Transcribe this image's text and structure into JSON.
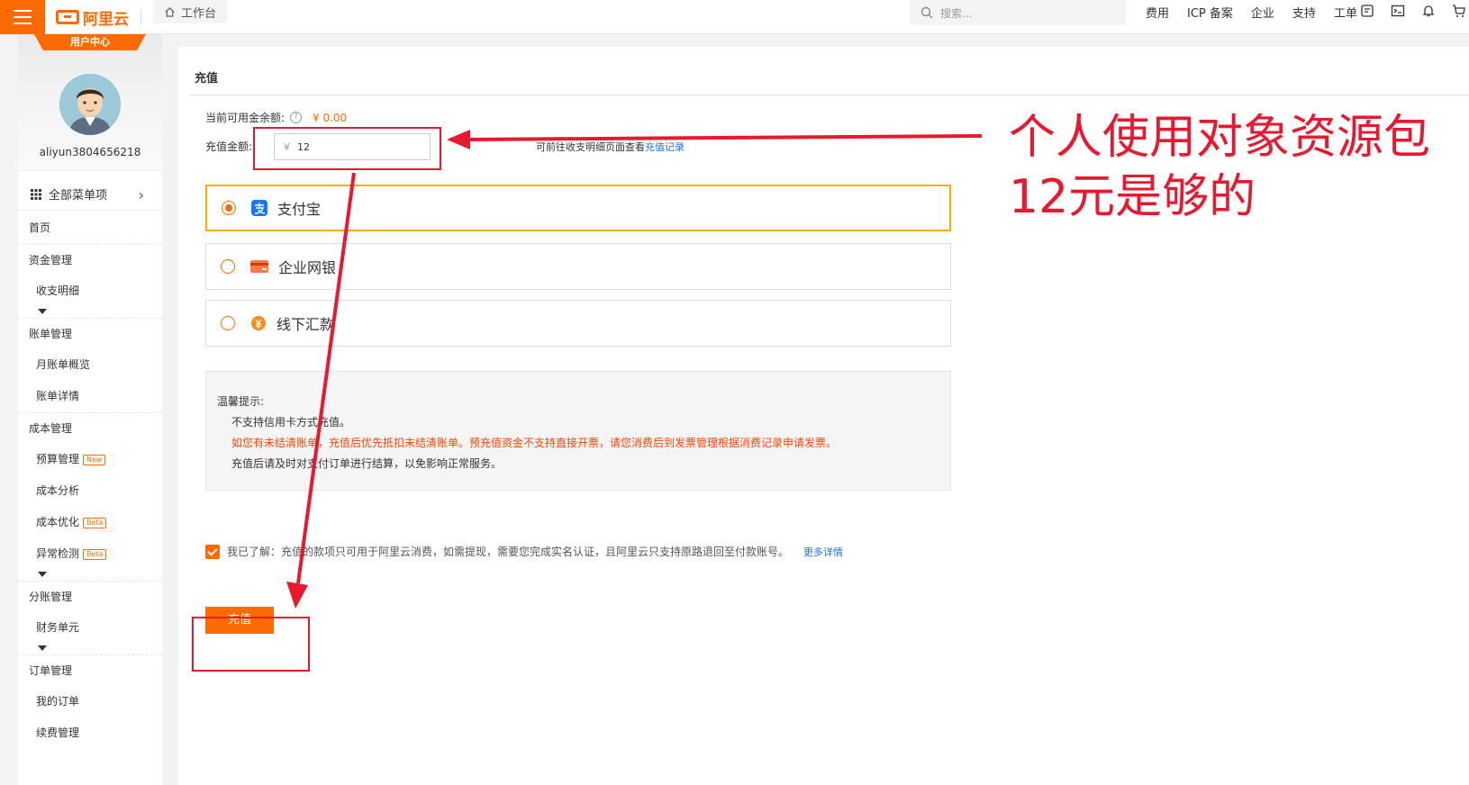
{
  "topbar": {
    "logo_text": "阿里云",
    "workbench_label": "工作台",
    "search_placeholder": "搜索...",
    "links": [
      "费用",
      "ICP 备案",
      "企业",
      "支持",
      "工单"
    ]
  },
  "sidebar": {
    "user_tag": "用户中心",
    "username": "aliyun3804656218",
    "all_menu_label": "全部菜单项",
    "items": [
      {
        "label": "首页",
        "type": "top"
      },
      {
        "label": "资金管理",
        "type": "group"
      },
      {
        "label": "收支明细",
        "type": "sub",
        "caret": true
      },
      {
        "label": "账单管理",
        "type": "group"
      },
      {
        "label": "月账单概览",
        "type": "sub"
      },
      {
        "label": "账单详情",
        "type": "sub"
      },
      {
        "label": "成本管理",
        "type": "group"
      },
      {
        "label": "预算管理",
        "type": "sub",
        "badge": "New"
      },
      {
        "label": "成本分析",
        "type": "sub"
      },
      {
        "label": "成本优化",
        "type": "sub",
        "badge": "Beta"
      },
      {
        "label": "异常检测",
        "type": "sub",
        "badge": "Beta",
        "caret": true
      },
      {
        "label": "分账管理",
        "type": "group"
      },
      {
        "label": "财务单元",
        "type": "sub",
        "caret": true
      },
      {
        "label": "订单管理",
        "type": "group"
      },
      {
        "label": "我的订单",
        "type": "sub"
      },
      {
        "label": "续费管理",
        "type": "sub"
      }
    ]
  },
  "main": {
    "title": "充值",
    "balance_label": "当前可用金余额:",
    "balance_value": "¥ 0.00",
    "amount_label": "充值金额:",
    "currency_symbol": "¥",
    "amount_value": "12",
    "record_hint": "可前往收支明细页面查看",
    "record_link": "充值记录",
    "payment_options": [
      {
        "label": "支付宝",
        "selected": true,
        "icon": "alipay-icon"
      },
      {
        "label": "企业网银",
        "selected": false,
        "icon": "bank-card-icon"
      },
      {
        "label": "线下汇款",
        "selected": false,
        "icon": "remittance-icon"
      }
    ],
    "tips": {
      "heading": "温馨提示:",
      "line1": "不支持信用卡方式充值。",
      "line2": "如您有未结清账单，充值后优先抵扣未结清账单。预充值资金不支持直接开票，请您消费后到发票管理根据消费记录申请发票。",
      "line3": "充值后请及时对支付订单进行结算，以免影响正常服务。"
    },
    "agreement_text": "我已了解：充值的款项只可用于阿里云消费，如需提现，需要您完成实名认证，且阿里云只支持原路退回至付款账号。",
    "agreement_link": "更多详情",
    "submit_label": "充值"
  },
  "annotation": {
    "line1": "个人使用对象资源包",
    "line2": "12元是够的",
    "color": "#e8182f"
  },
  "colors": {
    "accent": "#ff6a00",
    "selected_border": "#f5b100",
    "link": "#1a73e8"
  }
}
